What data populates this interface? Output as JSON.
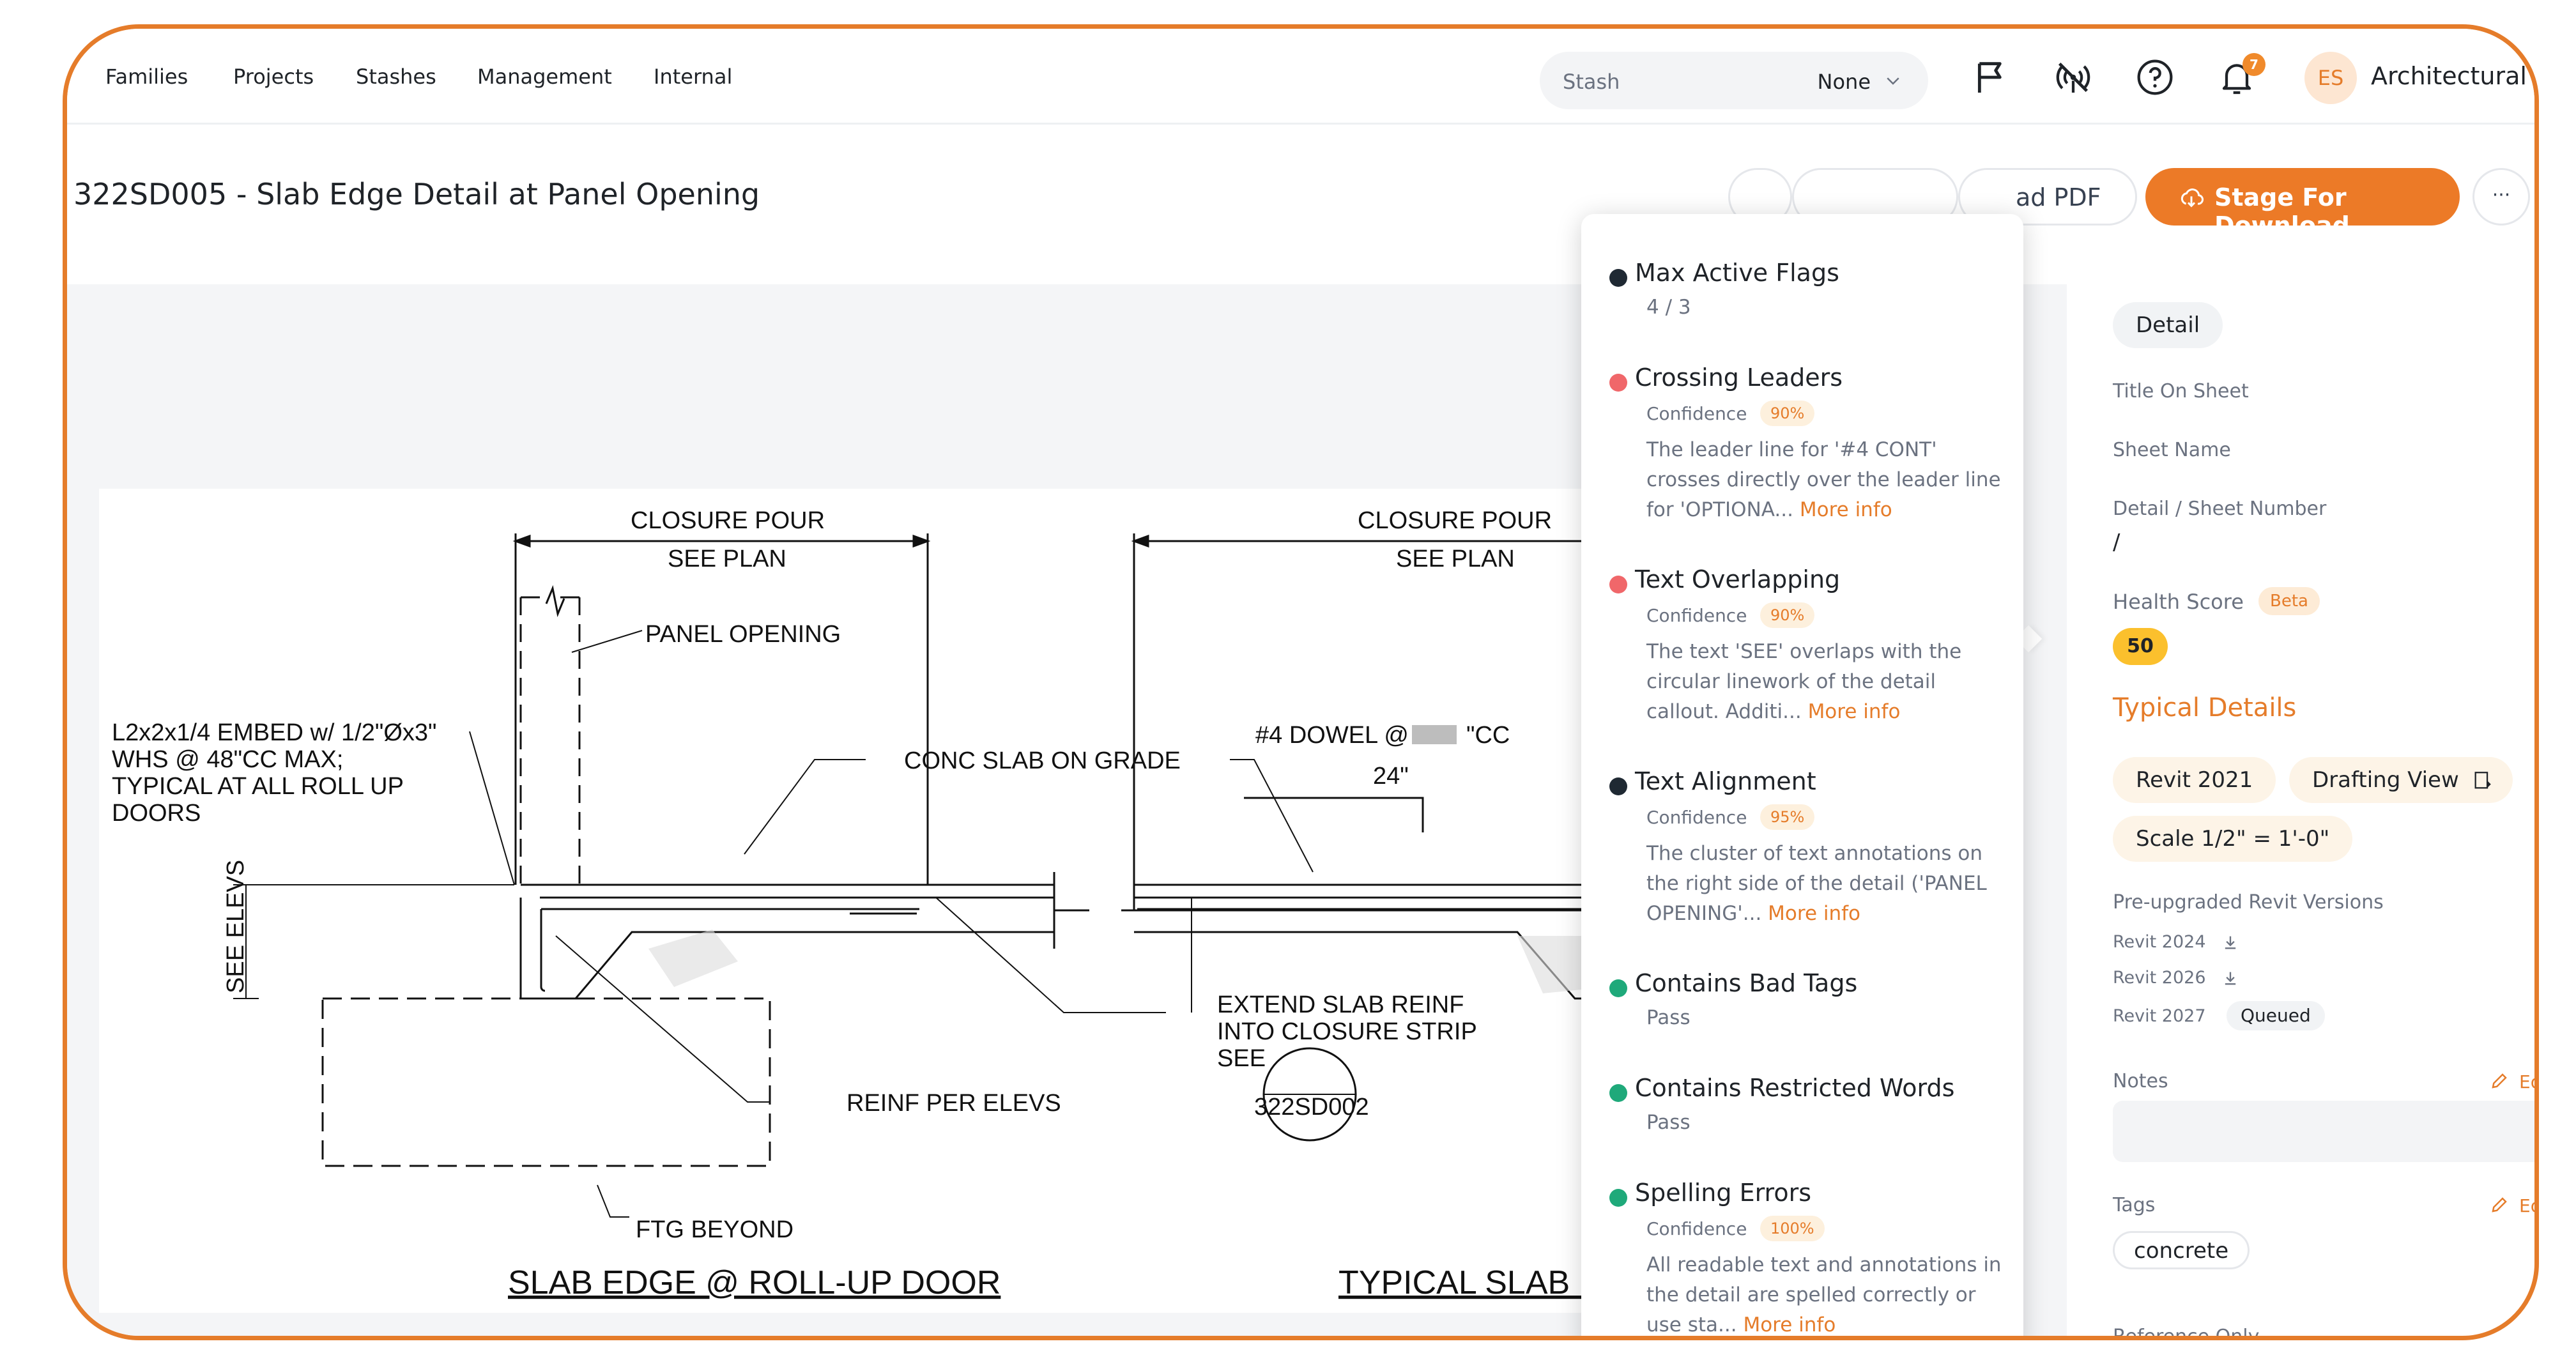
{
  "nav": {
    "links": [
      "Families",
      "Projects",
      "Stashes",
      "Management",
      "Internal"
    ],
    "stash_placeholder": "Stash",
    "stash_value": "None",
    "notification_count": "7",
    "avatar_initials": "ES",
    "account_name": "Architectural"
  },
  "header": {
    "title": "322SD005 - Slab Edge Detail at Panel Opening",
    "download_pdf_label": "ad PDF",
    "stage_label": "Stage For Download",
    "more_label": "···"
  },
  "drawing": {
    "left_title": "SLAB EDGE @ ROLL-UP DOOR",
    "right_title": "TYPICAL SLAB EDG",
    "closure_pour": "CLOSURE POUR",
    "see_plan": "SEE PLAN",
    "panel_opening": "PANEL OPENING",
    "embed_lines": [
      "L2x2x1/4 EMBED w/ 1/2\"Øx3\"",
      "WHS @ 48\"CC MAX;",
      "TYPICAL AT ALL ROLL UP",
      "DOORS"
    ],
    "conc_slab": "CONC SLAB ON GRADE",
    "dowel_a": "#4 DOWEL @",
    "dowel_b": "\"CC",
    "dowel_len": "24\"",
    "see_elevs": "SEE ELEVS",
    "extend_lines": [
      "EXTEND SLAB REINF",
      "INTO CLOSURE STRIP",
      "SEE"
    ],
    "detail_ref": "322SD002",
    "reinf": "REINF PER ELEVS",
    "ftg": "FTG BEYOND"
  },
  "checks": [
    {
      "title": "Max Active Flags",
      "status": "neutral",
      "sub": "4 / 3"
    },
    {
      "title": "Crossing Leaders",
      "status": "fail",
      "confidence_label": "Confidence",
      "confidence": "90%",
      "desc": "The leader line for '#4 CONT' crosses directly over the leader line for 'OPTIONA...",
      "more": "More info"
    },
    {
      "title": "Text Overlapping",
      "status": "fail",
      "confidence_label": "Confidence",
      "confidence": "90%",
      "desc": "The text 'SEE' overlaps with the circular linework of the detail callout. Additi...",
      "more": "More info"
    },
    {
      "title": "Text Alignment",
      "status": "neutral",
      "confidence_label": "Confidence",
      "confidence": "95%",
      "desc": "The cluster of text annotations on the right side of the detail ('PANEL OPENING'...",
      "more": "More info"
    },
    {
      "title": "Contains Bad Tags",
      "status": "pass",
      "sub": "Pass"
    },
    {
      "title": "Contains Restricted Words",
      "status": "pass",
      "sub": "Pass"
    },
    {
      "title": "Spelling Errors",
      "status": "pass",
      "confidence_label": "Confidence",
      "confidence": "100%",
      "desc": "All readable text and annotations in the detail are spelled correctly or use sta...",
      "more": "More info"
    }
  ],
  "colors": {
    "fail": "#f0676a",
    "pass": "#1fa97a",
    "neutral": "#1f2933",
    "accent": "#ec7a27"
  },
  "details": {
    "type_pill": "Detail",
    "title_on_sheet_label": "Title On Sheet",
    "sheet_name_label": "Sheet Name",
    "detail_sheet_label": "Detail / Sheet Number",
    "detail_sheet_value": "/",
    "health_label": "Health Score",
    "beta_label": "Beta",
    "health_score": "50",
    "typical_heading": "Typical Details",
    "revit_pill": "Revit 2021",
    "view_pill": "Drafting View",
    "scale_pill": "Scale 1/2\" = 1'-0\"",
    "pre_upgraded_label": "Pre-upgraded Revit Versions",
    "revit_versions": [
      "Revit 2024",
      "Revit 2026",
      "Revit 2027"
    ],
    "queued_label": "Queued",
    "notes_label": "Notes",
    "edit_label": "Edit",
    "tags_label": "Tags",
    "tag_value": "concrete",
    "reference_label": "Reference Only"
  }
}
